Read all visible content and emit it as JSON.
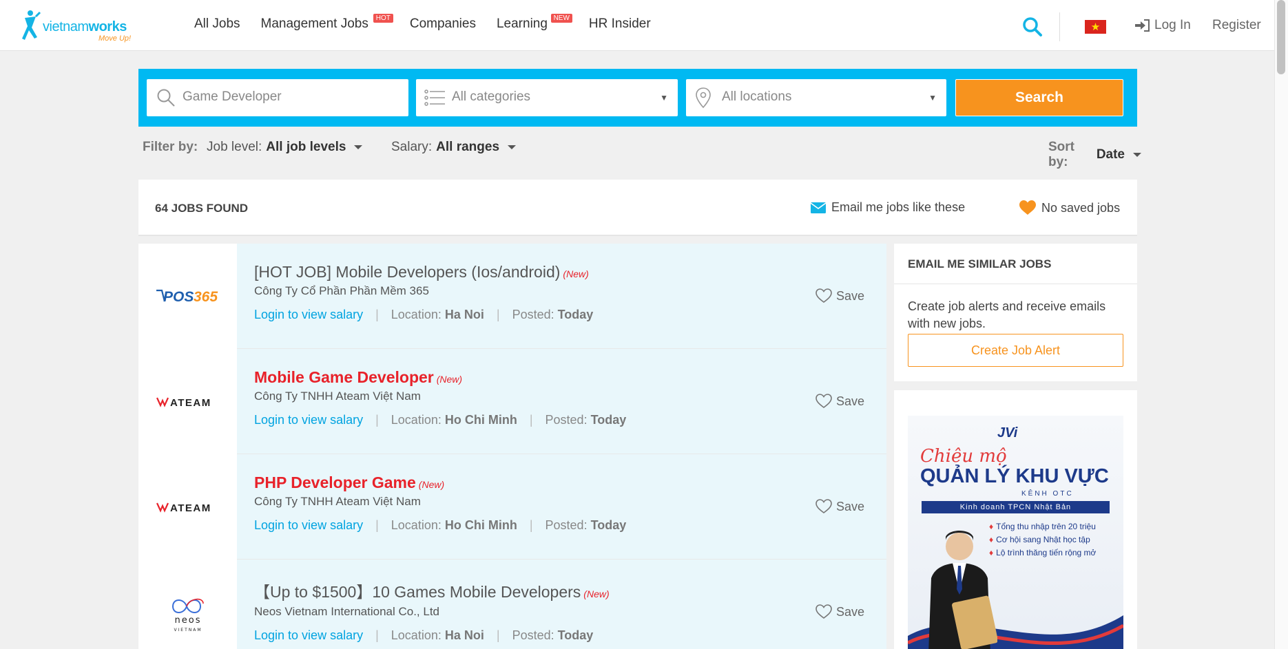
{
  "header": {
    "logo_text_a": "vietnam",
    "logo_text_b": "works",
    "logo_tagline": "Move Up!",
    "nav": [
      {
        "label": "All Jobs"
      },
      {
        "label": "Management Jobs",
        "badge": "HOT"
      },
      {
        "label": "Companies"
      },
      {
        "label": "Learning",
        "badge": "NEW"
      },
      {
        "label": "HR Insider"
      }
    ],
    "login": "Log In",
    "register": "Register",
    "accent": "#00b9f2"
  },
  "search": {
    "keyword_value": "Game Developer",
    "category_placeholder": "All categories",
    "location_placeholder": "All locations",
    "button": "Search"
  },
  "filters": {
    "filter_by": "Filter by:",
    "job_level_label": "Job level:",
    "job_level_value": "All job levels",
    "salary_label": "Salary:",
    "salary_value": "All ranges",
    "sort_label": "Sort by:",
    "sort_value": "Date"
  },
  "results": {
    "count": "64 JOBS FOUND",
    "email_me": "Email me jobs like these",
    "saved": "No saved jobs"
  },
  "jobs": [
    {
      "logo": "POS365",
      "title": "[HOT JOB] Mobile Developers (Ios/android)",
      "new": "(New)",
      "company": "Công Ty Cổ Phần Phần Mềm 365",
      "salary": "Login to view salary",
      "location_label": "Location:",
      "location": "Ha Noi",
      "posted_label": "Posted:",
      "posted": "Today",
      "save": "Save",
      "highlight": false
    },
    {
      "logo": "ATEAM",
      "title": "Mobile Game Developer",
      "new": "(New)",
      "company": "Công Ty TNHH Ateam Việt Nam",
      "salary": "Login to view salary",
      "location_label": "Location:",
      "location": "Ho Chi Minh",
      "posted_label": "Posted:",
      "posted": "Today",
      "save": "Save",
      "highlight": true
    },
    {
      "logo": "ATEAM",
      "title": "PHP Developer Game",
      "new": "(New)",
      "company": "Công Ty TNHH Ateam Việt Nam",
      "salary": "Login to view salary",
      "location_label": "Location:",
      "location": "Ho Chi Minh",
      "posted_label": "Posted:",
      "posted": "Today",
      "save": "Save",
      "highlight": true
    },
    {
      "logo": "neos",
      "title": "【Up to $1500】10 Games Mobile Developers",
      "new": "(New)",
      "company": "Neos Vietnam International Co., Ltd",
      "salary": "Login to view salary",
      "location_label": "Location:",
      "location": "Ha Noi",
      "posted_label": "Posted:",
      "posted": "Today",
      "save": "Save",
      "highlight": false
    }
  ],
  "logos": {
    "neos_sub": "VIETNAM"
  },
  "sidebar": {
    "title": "EMAIL ME SIMILAR JOBS",
    "text": "Create job alerts and receive emails with new jobs.",
    "button": "Create Job Alert"
  },
  "ad": {
    "logo": "JVi",
    "script": "Chiêu mộ",
    "headline": "QUẢN LÝ KHU VỰC",
    "sub": "KÊNH OTC",
    "band": "Kinh doanh TPCN Nhật Bản",
    "bullets": [
      "Tổng thu nhập trên 20 triệu",
      "Cơ hội sang Nhật học tập",
      "Lộ trình thăng tiến rộng mở"
    ]
  }
}
